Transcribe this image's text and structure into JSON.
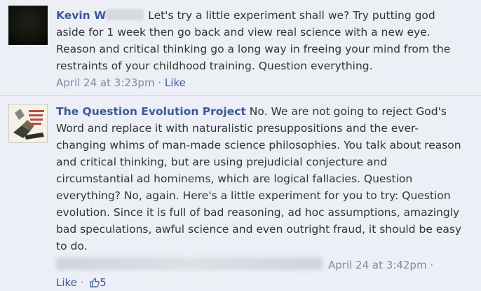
{
  "comment1": {
    "author": "Kevin W",
    "text": "Let's try a little experiment shall we? Try putting god aside for 1 week then go back and view real science with a new eye. Reason and critical thinking go a long way in freeing your mind from the restraints of your childhood training. Question everything.",
    "timestamp": "April 24 at 3:23pm",
    "separator": "·",
    "like_label": "Like"
  },
  "comment2": {
    "author": "The Question Evolution Project",
    "text": "No. We are not going to reject God's Word and replace it with naturalistic presuppositions and the ever-changing whims of man-made science philosophies. You talk about reason and critical thinking, but are using prejudicial conjecture and circumstantial ad hominems, which are logical fallacies. Question everything? No, again. Here's a little experiment for you to try: Question evolution. Since it is full of bad reasoning, ad hoc assumptions, amazingly bad speculations, awful science and even outright fraud, it should be easy to do.",
    "timestamp": "April 24 at 3:42pm",
    "separator": "·",
    "like_label": "Like",
    "like_count": "5"
  },
  "colors": {
    "background": "#eceff5",
    "link": "#3b5998",
    "meta": "#7f8aa6"
  }
}
